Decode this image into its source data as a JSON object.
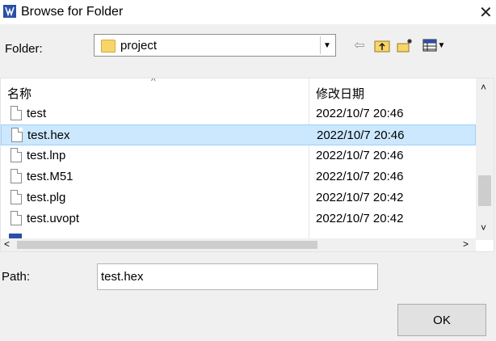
{
  "window": {
    "title": "Browse for Folder",
    "close_glyph": "✕"
  },
  "folder": {
    "label": "Folder:",
    "value": "project",
    "dropdown_glyph": "▼"
  },
  "toolbar": {
    "back_glyph": "⇦",
    "view_glyph": "▼"
  },
  "list": {
    "header_name": "名称",
    "header_date": "修改日期",
    "sort_glyph": "^",
    "rows": [
      {
        "name": "test",
        "date": "2022/10/7 20:46",
        "selected": false
      },
      {
        "name": "test.hex",
        "date": "2022/10/7 20:46",
        "selected": true
      },
      {
        "name": "test.lnp",
        "date": "2022/10/7 20:46",
        "selected": false
      },
      {
        "name": "test.M51",
        "date": "2022/10/7 20:46",
        "selected": false
      },
      {
        "name": "test.plg",
        "date": "2022/10/7 20:42",
        "selected": false
      },
      {
        "name": "test.uvopt",
        "date": "2022/10/7 20:42",
        "selected": false
      }
    ],
    "scroll_up": "˄",
    "scroll_down": "˅",
    "scroll_left": "<",
    "scroll_right": ">"
  },
  "path": {
    "label": "Path:",
    "value": "test.hex"
  },
  "buttons": {
    "ok": "OK"
  },
  "colors": {
    "selection_bg": "#cce8ff",
    "selection_border": "#99d1ff",
    "dialog_bg": "#f0f0f0"
  }
}
